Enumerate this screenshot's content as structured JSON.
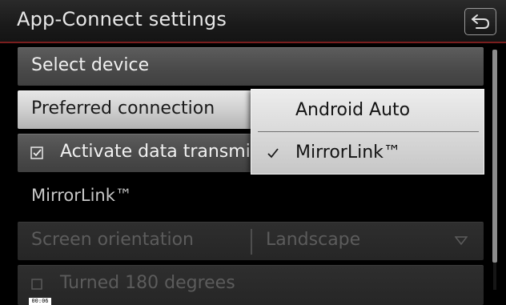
{
  "header": {
    "title": "App-Connect settings",
    "back_icon": "back-arrow-icon"
  },
  "list": {
    "select_device": "Select device",
    "preferred_connection": "Preferred connection",
    "activate_data": {
      "label": "Activate data transmi",
      "checked": true
    },
    "section_title": "MirrorLink™",
    "screen_orientation": {
      "label": "Screen orientation",
      "value": "Landscape",
      "enabled": false
    },
    "turned_180": {
      "label": "Turned 180 degrees",
      "checked": false,
      "enabled": false
    }
  },
  "popup": {
    "options": [
      {
        "label": "Android Auto",
        "selected": false
      },
      {
        "label": "MirrorLink™",
        "selected": true
      }
    ]
  },
  "timestamp": "00:06",
  "colors": {
    "header_accent": "#7a1e1e",
    "highlight_row": "#cfcfcf"
  }
}
